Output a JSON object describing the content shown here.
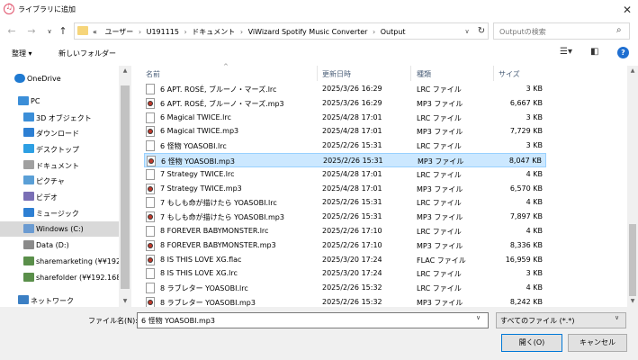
{
  "window": {
    "title": "ライブラリに追加",
    "close_icon": "close-icon"
  },
  "nav": {
    "back_icon": "arrow-left-icon",
    "forward_icon": "arrow-right-icon",
    "recent_icon": "chevron-down-icon",
    "up_icon": "arrow-up-icon",
    "path_prefix": "«",
    "path": [
      "ユーザー",
      "U191115",
      "ドキュメント",
      "ViWizard Spotify Music Converter",
      "Output"
    ],
    "path_separator": "›",
    "refresh_icon": "refresh-icon"
  },
  "search": {
    "placeholder": "Outputの検索",
    "icon": "search-icon"
  },
  "toolbar": {
    "organize": "整理 ▾",
    "new_folder": "新しいフォルダー",
    "view_icon": "view-list-icon",
    "preview_icon": "preview-pane-icon",
    "help": "?"
  },
  "navigation_pane": {
    "items": [
      {
        "label": "OneDrive",
        "icon": "cloud-icon",
        "color": "#1f7ad1"
      },
      {
        "label": "PC",
        "icon": "pc-icon",
        "color": "#3b8ed8"
      },
      {
        "label": "3D オブジェクト",
        "icon": "cube-icon",
        "color": "#3b8ed8"
      },
      {
        "label": "ダウンロード",
        "icon": "download-icon",
        "color": "#2d7fd3"
      },
      {
        "label": "デスクトップ",
        "icon": "desktop-icon",
        "color": "#2d9fe3"
      },
      {
        "label": "ドキュメント",
        "icon": "document-icon",
        "color": "#a0a0a0"
      },
      {
        "label": "ピクチャ",
        "icon": "picture-icon",
        "color": "#5a9fd6"
      },
      {
        "label": "ビデオ",
        "icon": "video-icon",
        "color": "#7a6fb5"
      },
      {
        "label": "ミュージック",
        "icon": "music-icon",
        "color": "#2d7fd3"
      },
      {
        "label": "Windows (C:)",
        "icon": "drive-icon",
        "color": "#6b9bd1"
      },
      {
        "label": "Data (D:)",
        "icon": "drive-icon",
        "color": "#8a8a8a"
      },
      {
        "label": "sharemarketing (¥¥192.",
        "icon": "network-drive-icon",
        "color": "#5a8f4a"
      },
      {
        "label": "sharefolder (¥¥192.168.",
        "icon": "network-drive-icon",
        "color": "#5a8f4a"
      },
      {
        "label": "ネットワーク",
        "icon": "network-icon",
        "color": "#3b7fc4"
      }
    ]
  },
  "file_list": {
    "columns": [
      "名前",
      "更新日時",
      "種類",
      "サイズ"
    ],
    "rows": [
      {
        "name": "6 APT. ROSÉ, ブルーノ・マーズ.lrc",
        "date": "2025/3/26 16:29",
        "type": "LRC ファイル",
        "size": "3 KB",
        "kind": "lrc"
      },
      {
        "name": "6 APT. ROSÉ, ブルーノ・マーズ.mp3",
        "date": "2025/3/26 16:29",
        "type": "MP3 ファイル",
        "size": "6,667 KB",
        "kind": "mp3"
      },
      {
        "name": "6 Magical TWICE.lrc",
        "date": "2025/4/28 17:01",
        "type": "LRC ファイル",
        "size": "3 KB",
        "kind": "lrc"
      },
      {
        "name": "6 Magical TWICE.mp3",
        "date": "2025/4/28 17:01",
        "type": "MP3 ファイル",
        "size": "7,729 KB",
        "kind": "mp3"
      },
      {
        "name": "6 怪物 YOASOBI.lrc",
        "date": "2025/2/26 15:31",
        "type": "LRC ファイル",
        "size": "3 KB",
        "kind": "lrc"
      },
      {
        "name": "6 怪物 YOASOBI.mp3",
        "date": "2025/2/26 15:31",
        "type": "MP3 ファイル",
        "size": "8,047 KB",
        "kind": "mp3",
        "selected": true
      },
      {
        "name": "7 Strategy TWICE.lrc",
        "date": "2025/4/28 17:01",
        "type": "LRC ファイル",
        "size": "4 KB",
        "kind": "lrc"
      },
      {
        "name": "7 Strategy TWICE.mp3",
        "date": "2025/4/28 17:01",
        "type": "MP3 ファイル",
        "size": "6,570 KB",
        "kind": "mp3"
      },
      {
        "name": "7 もしも命が描けたら YOASOBI.lrc",
        "date": "2025/2/26 15:31",
        "type": "LRC ファイル",
        "size": "4 KB",
        "kind": "lrc"
      },
      {
        "name": "7 もしも命が描けたら YOASOBI.mp3",
        "date": "2025/2/26 15:31",
        "type": "MP3 ファイル",
        "size": "7,897 KB",
        "kind": "mp3"
      },
      {
        "name": "8 FOREVER BABYMONSTER.lrc",
        "date": "2025/2/26 17:10",
        "type": "LRC ファイル",
        "size": "4 KB",
        "kind": "lrc"
      },
      {
        "name": "8 FOREVER BABYMONSTER.mp3",
        "date": "2025/2/26 17:10",
        "type": "MP3 ファイル",
        "size": "8,336 KB",
        "kind": "mp3"
      },
      {
        "name": "8 IS THIS LOVE XG.flac",
        "date": "2025/3/20 17:24",
        "type": "FLAC ファイル",
        "size": "16,959 KB",
        "kind": "flac"
      },
      {
        "name": "8 IS THIS LOVE XG.lrc",
        "date": "2025/3/20 17:24",
        "type": "LRC ファイル",
        "size": "3 KB",
        "kind": "lrc"
      },
      {
        "name": "8 ラブレター YOASOBI.lrc",
        "date": "2025/2/26 15:32",
        "type": "LRC ファイル",
        "size": "4 KB",
        "kind": "lrc"
      },
      {
        "name": "8 ラブレター YOASOBI.mp3",
        "date": "2025/2/26 15:32",
        "type": "MP3 ファイル",
        "size": "8,242 KB",
        "kind": "mp3"
      }
    ]
  },
  "footer": {
    "filename_label": "ファイル名(N):",
    "filename_value": "6 怪物 YOASOBI.mp3",
    "filetype_value": "すべてのファイル (*.*)",
    "open_label": "開く(O)",
    "cancel_label": "キャンセル"
  }
}
